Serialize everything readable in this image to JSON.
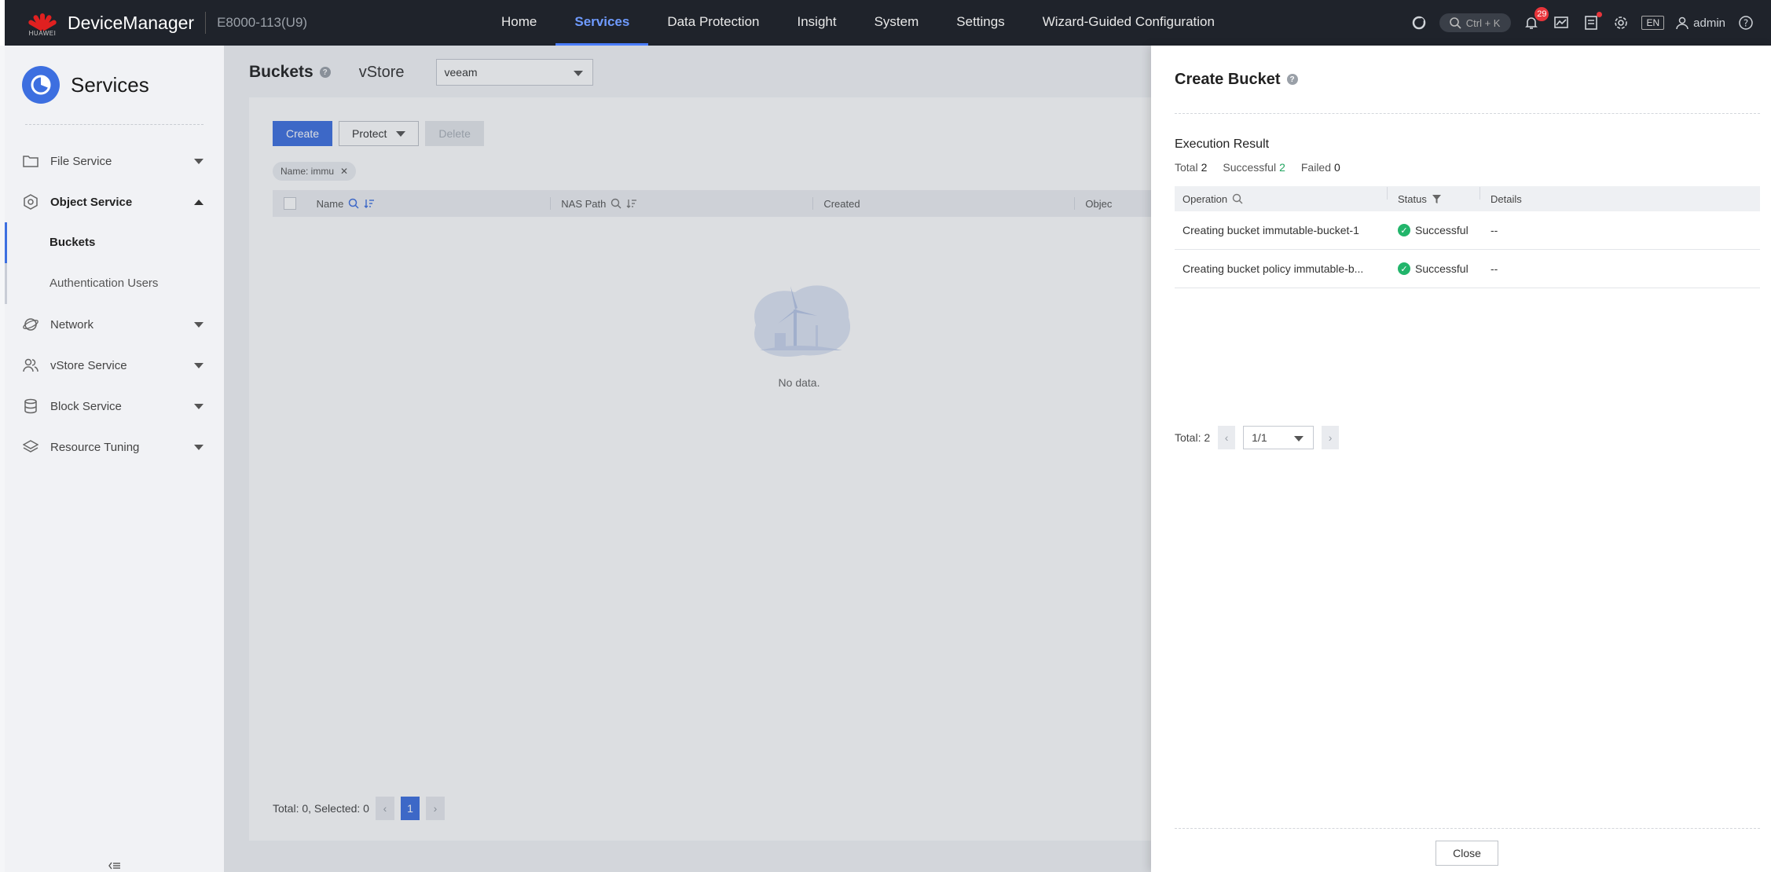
{
  "topbar": {
    "logo_text": "HUAWEI",
    "brand": "DeviceManager",
    "device": "E8000-113(U9)",
    "nav": [
      "Home",
      "Services",
      "Data Protection",
      "Insight",
      "System",
      "Settings",
      "Wizard-Guided Configuration"
    ],
    "search_shortcut": "Ctrl + K",
    "alarm_count": "29",
    "language": "EN",
    "user": "admin"
  },
  "sidebar": {
    "title": "Services",
    "items": {
      "file": "File Service",
      "object": "Object Service",
      "buckets": "Buckets",
      "auth_users": "Authentication Users",
      "network": "Network",
      "vstore": "vStore Service",
      "block": "Block Service",
      "tuning": "Resource Tuning"
    }
  },
  "main": {
    "title": "Buckets",
    "vstore_label": "vStore",
    "vstore_value": "veeam",
    "create": "Create",
    "protect": "Protect",
    "delete": "Delete",
    "filter_chip": "Name: immu",
    "columns": [
      "Name",
      "NAS Path",
      "Created",
      "Objec"
    ],
    "empty": "No data.",
    "pager_text": "Total: 0, Selected: 0",
    "page": "1"
  },
  "drawer": {
    "title": "Create Bucket",
    "exec_title": "Execution Result",
    "total_label": "Total",
    "total": "2",
    "successful_label": "Successful",
    "successful": "2",
    "failed_label": "Failed",
    "failed": "0",
    "columns": [
      "Operation",
      "Status",
      "Details"
    ],
    "rows": [
      {
        "operation": "Creating bucket immutable-bucket-1",
        "status": "Successful",
        "details": "--"
      },
      {
        "operation": "Creating bucket policy immutable-b...",
        "status": "Successful",
        "details": "--"
      }
    ],
    "pager_total": "Total: 2",
    "pager_page": "1/1",
    "close": "Close"
  }
}
